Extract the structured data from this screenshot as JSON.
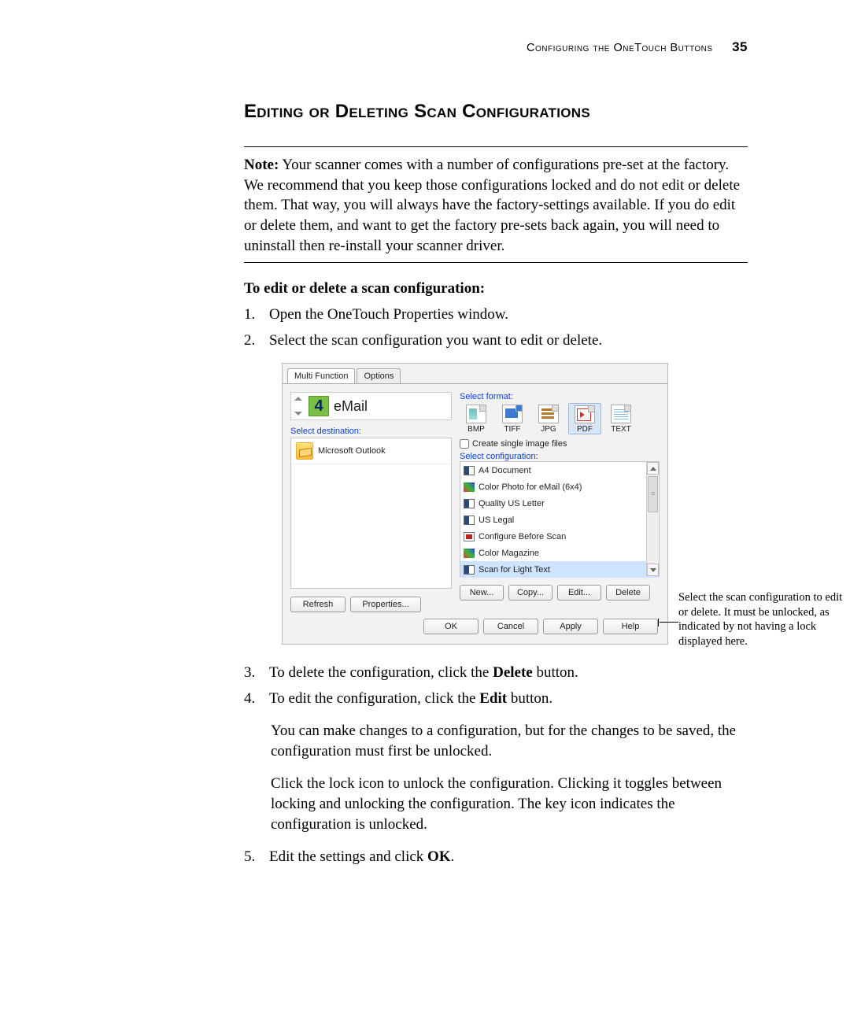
{
  "header": {
    "text": "Configuring the OneTouch Buttons",
    "page": "35"
  },
  "section_title": "Editing or Deleting Scan Configurations",
  "note_label": "Note:",
  "note_body": " Your scanner comes with a number of configurations pre-set at the factory. We recommend that you keep those configurations locked and do not edit or delete them. That way, you will always have the factory-settings available. If you do edit or delete them, and want to get the factory pre-sets back again, you will need to uninstall then re-install your scanner driver.",
  "subhead": "To edit or delete a scan configuration:",
  "steps_top": [
    {
      "n": "1.",
      "t": "Open the OneTouch Properties window."
    },
    {
      "n": "2.",
      "t": "Select the scan configuration you want to edit or delete."
    }
  ],
  "dialog": {
    "tabs": [
      "Multi Function",
      "Options"
    ],
    "function_number": "4",
    "function_name": "eMail",
    "select_destination_label": "Select destination:",
    "destination_item": "Microsoft Outlook",
    "select_format_label": "Select format:",
    "formats": [
      "BMP",
      "TIFF",
      "JPG",
      "PDF",
      "TEXT"
    ],
    "format_selected": "PDF",
    "checkbox": "Create single image files",
    "select_config_label": "Select configuration:",
    "config_items": [
      {
        "name": "A4 Document",
        "icon": "bw",
        "lock": true
      },
      {
        "name": "Color Photo for eMail (6x4)",
        "icon": "col",
        "lock": true
      },
      {
        "name": "Quality US Letter",
        "icon": "bw",
        "lock": true
      },
      {
        "name": "US Legal",
        "icon": "bw",
        "lock": true
      },
      {
        "name": "Configure Before Scan",
        "icon": "cfg",
        "lock": true
      },
      {
        "name": "Color Magazine",
        "icon": "col",
        "lock": true
      },
      {
        "name": "Scan for Light Text",
        "icon": "bw",
        "lock": false,
        "selected": true
      }
    ],
    "left_buttons": [
      "Refresh",
      "Properties..."
    ],
    "cfg_buttons": [
      "New...",
      "Copy...",
      "Edit...",
      "Delete"
    ],
    "bottom_buttons": [
      "OK",
      "Cancel",
      "Apply",
      "Help"
    ]
  },
  "callout_text": "Select the scan configuration to edit or delete. It must be unlocked, as indicated by not having a lock displayed here.",
  "steps_bottom": [
    {
      "n": "3.",
      "t_pre": "To delete the configuration, click the ",
      "bold": "Delete",
      "t_post": " button."
    },
    {
      "n": "4.",
      "t_pre": "To edit the configuration, click the ",
      "bold": "Edit",
      "t_post": " button."
    }
  ],
  "para1": "You can make changes to a configuration, but for the changes to be saved, the configuration must first be unlocked.",
  "para2": "Click the lock icon to unlock the configuration. Clicking it toggles between locking and unlocking the configuration. The key icon indicates the configuration is unlocked.",
  "step5": {
    "n": "5.",
    "t_pre": "Edit the settings and click ",
    "bold": "OK",
    "t_post": "."
  }
}
